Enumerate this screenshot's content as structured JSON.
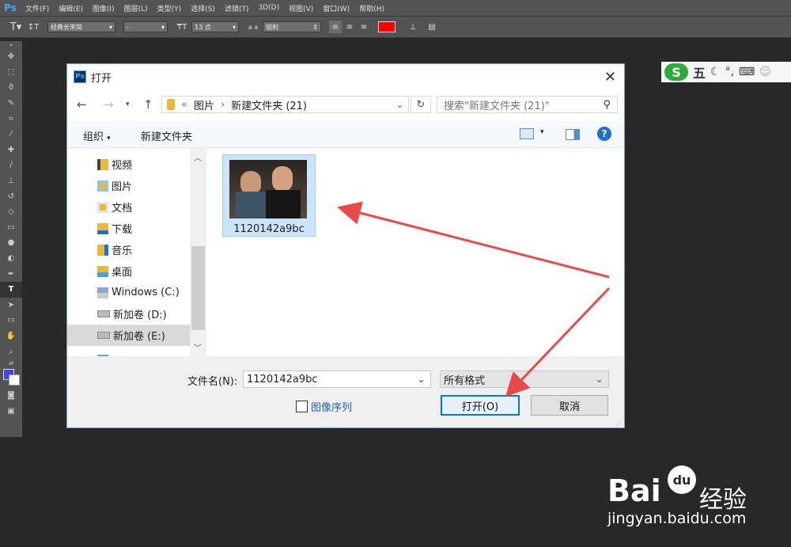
{
  "menubar": {
    "logo": "Ps",
    "items": [
      "文件(F)",
      "编辑(E)",
      "图像(I)",
      "图层(L)",
      "类型(Y)",
      "选择(S)",
      "滤镜(T)",
      "3D(D)",
      "视图(V)",
      "窗口(W)",
      "帮助(H)"
    ]
  },
  "options": {
    "font_family": "经典长宋简",
    "font_style": "-",
    "font_size": "13 点",
    "aa_label": "a a",
    "antialias": "锐利",
    "text_color": "#ff0000"
  },
  "ime": {
    "logo": "S",
    "mode": "五",
    "items": [
      "moon-icon",
      "punct-icon",
      "keyboard-icon",
      "user-icon"
    ]
  },
  "dialog": {
    "title": "打开",
    "path": {
      "prefix": "«",
      "parts": [
        "图片",
        "新建文件夹 (21)"
      ]
    },
    "search_placeholder": "搜索\"新建文件夹 (21)\"",
    "commands": {
      "organize": "组织",
      "new_folder": "新建文件夹"
    },
    "nav_items": [
      {
        "label": "视频",
        "icon": "video-folder-icon"
      },
      {
        "label": "图片",
        "icon": "pictures-folder-icon"
      },
      {
        "label": "文档",
        "icon": "documents-folder-icon"
      },
      {
        "label": "下载",
        "icon": "downloads-folder-icon"
      },
      {
        "label": "音乐",
        "icon": "music-folder-icon"
      },
      {
        "label": "桌面",
        "icon": "desktop-folder-icon"
      },
      {
        "label": "Windows (C:)",
        "icon": "windows-drive-icon"
      },
      {
        "label": "新加卷 (D:)",
        "icon": "drive-icon"
      },
      {
        "label": "新加卷 (E:)",
        "icon": "drive-icon",
        "selected": true
      }
    ],
    "files": [
      {
        "name": "1120142a9bc"
      }
    ],
    "filename_label": "文件名(N):",
    "filename_value": "1120142a9bc",
    "filetype_value": "所有格式",
    "image_sequence_label": "图像序列",
    "open_button": "打开(O)",
    "cancel_button": "取消"
  },
  "watermark": {
    "brand": "Bai",
    "brand_cn": "经验",
    "url": "jingyan.baidu.com"
  },
  "colors": {
    "accent": "#0078d7",
    "arrow": "#e84a4a",
    "ps_bg": "#535353"
  }
}
